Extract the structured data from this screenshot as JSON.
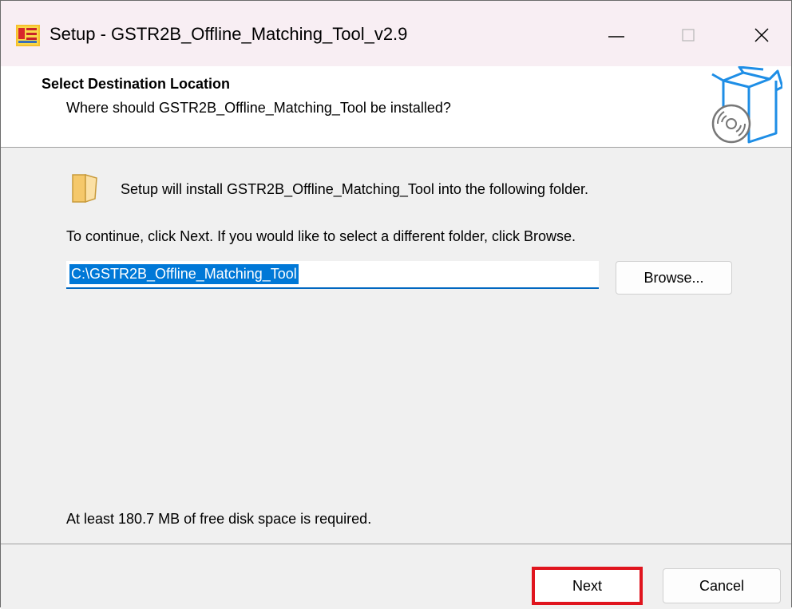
{
  "window": {
    "title": "Setup - GSTR2B_Offline_Matching_Tool_v2.9",
    "app_icon": "installer-app-icon",
    "controls": {
      "minimize": "minimize-icon",
      "maximize": "maximize-icon",
      "close": "close-icon"
    }
  },
  "header": {
    "title": "Select Destination Location",
    "subtitle": "Where should GSTR2B_Offline_Matching_Tool be installed?",
    "graphic": "box-with-disc-icon"
  },
  "body": {
    "folder_icon": "folder-icon",
    "intro": "Setup will install GSTR2B_Offline_Matching_Tool into the following folder.",
    "continue_hint": "To continue, click Next. If you would like to select a different folder, click Browse.",
    "path": {
      "value": "C:\\GSTR2B_Offline_Matching_Tool"
    },
    "browse_label": "Browse...",
    "disk_space": "At least 180.7 MB of free disk space is required."
  },
  "footer": {
    "next_label": "Next",
    "cancel_label": "Cancel"
  },
  "colors": {
    "titlebar": "#f8eef3",
    "selection": "#0078d7",
    "highlight": "#e0151e",
    "accent_blue": "#1e8ee6"
  }
}
